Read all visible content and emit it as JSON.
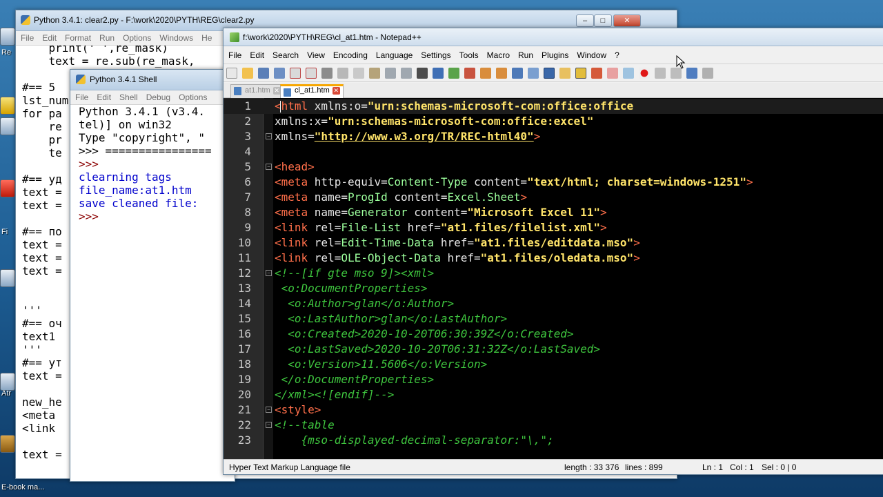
{
  "desktop": {
    "icon_labels": [
      "Re",
      "Fi",
      "Atr",
      "E-book ma..."
    ]
  },
  "editor_window": {
    "title": "Python 3.4.1: clear2.py - F:\\work\\2020\\PYTH\\REG\\clear2.py",
    "menu": [
      "File",
      "Edit",
      "Format",
      "Run",
      "Options",
      "Windows",
      "He"
    ],
    "lines": [
      "    print(' ',re_mask)",
      "    text = re.sub(re_mask,",
      "",
      "#== 5",
      "lst_num",
      "for pa",
      "    re",
      "    pr",
      "    te",
      "",
      "#== уд",
      "text =",
      "text =",
      "",
      "#== по",
      "text =",
      "text =",
      "text =",
      "",
      "",
      "'''",
      "#== оч",
      "text1",
      "'''",
      "#== ут",
      "text =",
      "",
      "new_he",
      "<meta",
      "<link",
      "",
      "text ="
    ]
  },
  "shell_window": {
    "title": "Python 3.4.1 Shell",
    "menu": [
      "File",
      "Edit",
      "Shell",
      "Debug",
      "Options"
    ],
    "lines": [
      {
        "text": "Python 3.4.1 (v3.4.",
        "color": "#000000"
      },
      {
        "text": "tel)] on win32",
        "color": "#000000"
      },
      {
        "text": "Type \"copyright\", \"",
        "color": "#000000"
      },
      {
        "text": ">>> ================",
        "color": "#000000"
      },
      {
        "text": ">>>",
        "color": "#8b0000"
      },
      {
        "text": "clearning tags",
        "color": "#0000cc"
      },
      {
        "text": "file_name:at1.htm",
        "color": "#0000cc"
      },
      {
        "text": "save cleaned file:",
        "color": "#0000cc"
      },
      {
        "text": ">>>",
        "color": "#8b0000"
      }
    ]
  },
  "npp": {
    "title": "f:\\work\\2020\\PYTH\\REG\\cl_at1.htm - Notepad++",
    "menu": [
      "File",
      "Edit",
      "Search",
      "View",
      "Encoding",
      "Language",
      "Settings",
      "Tools",
      "Macro",
      "Run",
      "Plugins",
      "Window",
      "?"
    ],
    "tabs": [
      {
        "label": "at1.htm",
        "active": false
      },
      {
        "label": "cl_at1.htm",
        "active": true
      }
    ],
    "colors": {
      "tag": "#ff6f4a",
      "attr": "#e6e6e6",
      "string": "#ffe46a",
      "value": "#9cff9c",
      "comment": "#3ec43e",
      "url": "#ffe46a"
    },
    "code_lines": [
      {
        "n": "1",
        "fold": "",
        "cur": true,
        "segs": [
          [
            "tag",
            "<html "
          ],
          [
            "attr",
            "xmlns:o="
          ],
          [
            "string",
            "\"urn:schemas-microsoft-com:office:office"
          ]
        ]
      },
      {
        "n": "2",
        "fold": "",
        "segs": [
          [
            "attr",
            "xmlns:x="
          ],
          [
            "string",
            "\"urn:schemas-microsoft-com:office:excel\""
          ]
        ]
      },
      {
        "n": "3",
        "fold": "-",
        "segs": [
          [
            "attr",
            "xmlns="
          ],
          [
            "url",
            "\"http://www.w3.org/TR/REC-html40\""
          ],
          [
            "tag",
            ">"
          ]
        ]
      },
      {
        "n": "4",
        "fold": "",
        "segs": []
      },
      {
        "n": "5",
        "fold": "-",
        "segs": [
          [
            "tag",
            "<head>"
          ]
        ]
      },
      {
        "n": "6",
        "fold": "",
        "segs": [
          [
            "tag",
            "<meta "
          ],
          [
            "attr",
            "http-equiv="
          ],
          [
            "value",
            "Content-Type "
          ],
          [
            "attr",
            "content="
          ],
          [
            "string",
            "\"text/html; charset=windows-1251\""
          ],
          [
            "tag",
            ">"
          ]
        ]
      },
      {
        "n": "7",
        "fold": "",
        "segs": [
          [
            "tag",
            "<meta "
          ],
          [
            "attr",
            "name="
          ],
          [
            "value",
            "ProgId "
          ],
          [
            "attr",
            "content="
          ],
          [
            "value",
            "Excel.Sheet"
          ],
          [
            "tag",
            ">"
          ]
        ]
      },
      {
        "n": "8",
        "fold": "",
        "segs": [
          [
            "tag",
            "<meta "
          ],
          [
            "attr",
            "name="
          ],
          [
            "value",
            "Generator "
          ],
          [
            "attr",
            "content="
          ],
          [
            "string",
            "\"Microsoft Excel 11\""
          ],
          [
            "tag",
            ">"
          ]
        ]
      },
      {
        "n": "9",
        "fold": "",
        "segs": [
          [
            "tag",
            "<link "
          ],
          [
            "attr",
            "rel="
          ],
          [
            "value",
            "File-List "
          ],
          [
            "attr",
            "href="
          ],
          [
            "string",
            "\"at1.files/filelist.xml\""
          ],
          [
            "tag",
            ">"
          ]
        ]
      },
      {
        "n": "10",
        "fold": "",
        "segs": [
          [
            "tag",
            "<link "
          ],
          [
            "attr",
            "rel="
          ],
          [
            "value",
            "Edit-Time-Data "
          ],
          [
            "attr",
            "href="
          ],
          [
            "string",
            "\"at1.files/editdata.mso\""
          ],
          [
            "tag",
            ">"
          ]
        ]
      },
      {
        "n": "11",
        "fold": "",
        "segs": [
          [
            "tag",
            "<link "
          ],
          [
            "attr",
            "rel="
          ],
          [
            "value",
            "OLE-Object-Data "
          ],
          [
            "attr",
            "href="
          ],
          [
            "string",
            "\"at1.files/oledata.mso\""
          ],
          [
            "tag",
            ">"
          ]
        ]
      },
      {
        "n": "12",
        "fold": "-",
        "segs": [
          [
            "comment",
            "<!--[if gte mso 9]><xml>"
          ]
        ]
      },
      {
        "n": "13",
        "fold": "",
        "segs": [
          [
            "comment",
            " <o:DocumentProperties>"
          ]
        ]
      },
      {
        "n": "14",
        "fold": "",
        "segs": [
          [
            "comment",
            "  <o:Author>glan</o:Author>"
          ]
        ]
      },
      {
        "n": "15",
        "fold": "",
        "segs": [
          [
            "comment",
            "  <o:LastAuthor>glan</o:LastAuthor>"
          ]
        ]
      },
      {
        "n": "16",
        "fold": "",
        "segs": [
          [
            "comment",
            "  <o:Created>2020-10-20T06:30:39Z</o:Created>"
          ]
        ]
      },
      {
        "n": "17",
        "fold": "",
        "segs": [
          [
            "comment",
            "  <o:LastSaved>2020-10-20T06:31:32Z</o:LastSaved>"
          ]
        ]
      },
      {
        "n": "18",
        "fold": "",
        "segs": [
          [
            "comment",
            "  <o:Version>11.5606</o:Version>"
          ]
        ]
      },
      {
        "n": "19",
        "fold": "",
        "segs": [
          [
            "comment",
            " </o:DocumentProperties>"
          ]
        ]
      },
      {
        "n": "20",
        "fold": "",
        "segs": [
          [
            "comment",
            "</xml><![endif]-->"
          ]
        ]
      },
      {
        "n": "21",
        "fold": "-",
        "segs": [
          [
            "tag",
            "<style>"
          ]
        ]
      },
      {
        "n": "22",
        "fold": "-",
        "segs": [
          [
            "comment",
            "<!--table"
          ]
        ]
      },
      {
        "n": "23",
        "fold": "",
        "segs": [
          [
            "comment",
            "    {mso-displayed-decimal-separator:\"\\,\";"
          ]
        ]
      }
    ],
    "status": {
      "filetype": "Hyper Text Markup Language file",
      "length": "length : 33 376",
      "lines": "lines : 899",
      "ln": "Ln : 1",
      "col": "Col : 1",
      "sel": "Sel : 0 | 0"
    }
  }
}
